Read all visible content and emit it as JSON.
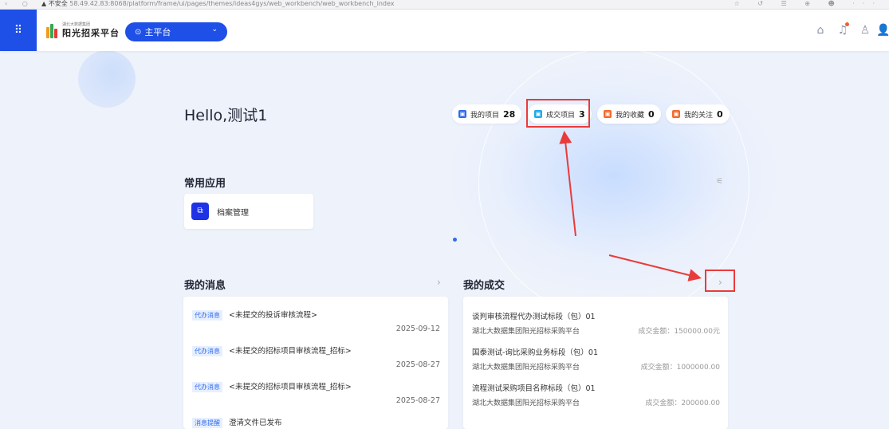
{
  "browser": {
    "nav": "‹ ○",
    "security": "▲ 不安全",
    "url": "58.49.42.83:8068/platform/frame/ui/pages/themes/ideas4gys/web_workbench/web_workbench_index",
    "tools": "☆ ↺ ☰ ⊕ ☻ ···"
  },
  "header": {
    "apps_icon": "⠿",
    "logo_small": "湖北大数据集团",
    "logo_name": "阳光招采平台",
    "platform_icon": "⊙",
    "platform_value": "主平台",
    "platform_chevron": "⌄",
    "home_icon": "⌂",
    "bell_icon": "♫",
    "shirt_icon": "♙",
    "user_icon": "👤"
  },
  "greeting": "Hello,测试1",
  "stats": [
    {
      "label": "我的项目",
      "value": "28",
      "color": "#2f6bf0"
    },
    {
      "label": "成交项目",
      "value": "3",
      "color": "#1fa9f0"
    },
    {
      "label": "我的收藏",
      "value": "0",
      "color": "#f26b2c"
    },
    {
      "label": "我的关注",
      "value": "0",
      "color": "#f26b2c"
    }
  ],
  "common_apps": {
    "title": "常用应用",
    "settings_icon": "⚟",
    "items": [
      {
        "icon": "⧉",
        "label": "档案管理"
      }
    ]
  },
  "messages": {
    "title": "我的消息",
    "more": "›",
    "items": [
      {
        "tag": "代办消息",
        "text": "<未提交的投诉审核流程>",
        "date": "2025-09-12"
      },
      {
        "tag": "代办消息",
        "text": "<未提交的招标项目审核流程_招标>",
        "date": "2025-08-27"
      },
      {
        "tag": "代办消息",
        "text": "<未提交的招标项目审核流程_招标>",
        "date": "2025-08-27"
      },
      {
        "tag": "消息提醒",
        "text": "澄清文件已发布",
        "date": ""
      }
    ]
  },
  "deals": {
    "title": "我的成交",
    "more": "›",
    "items": [
      {
        "title": "谈判审核流程代办测试标段（包）01",
        "org": "湖北大数据集团阳光招标采购平台",
        "amount": "成交金额：150000.00元"
      },
      {
        "title": "国泰测试-询比采购业务标段（包）01",
        "org": "湖北大数据集团阳光招标采购平台",
        "amount": "成交金额：1000000.00"
      },
      {
        "title": "流程测试采购项目名称标段（包）01",
        "org": "湖北大数据集团阳光招标采购平台",
        "amount": "成交金额：200000.00"
      }
    ]
  }
}
